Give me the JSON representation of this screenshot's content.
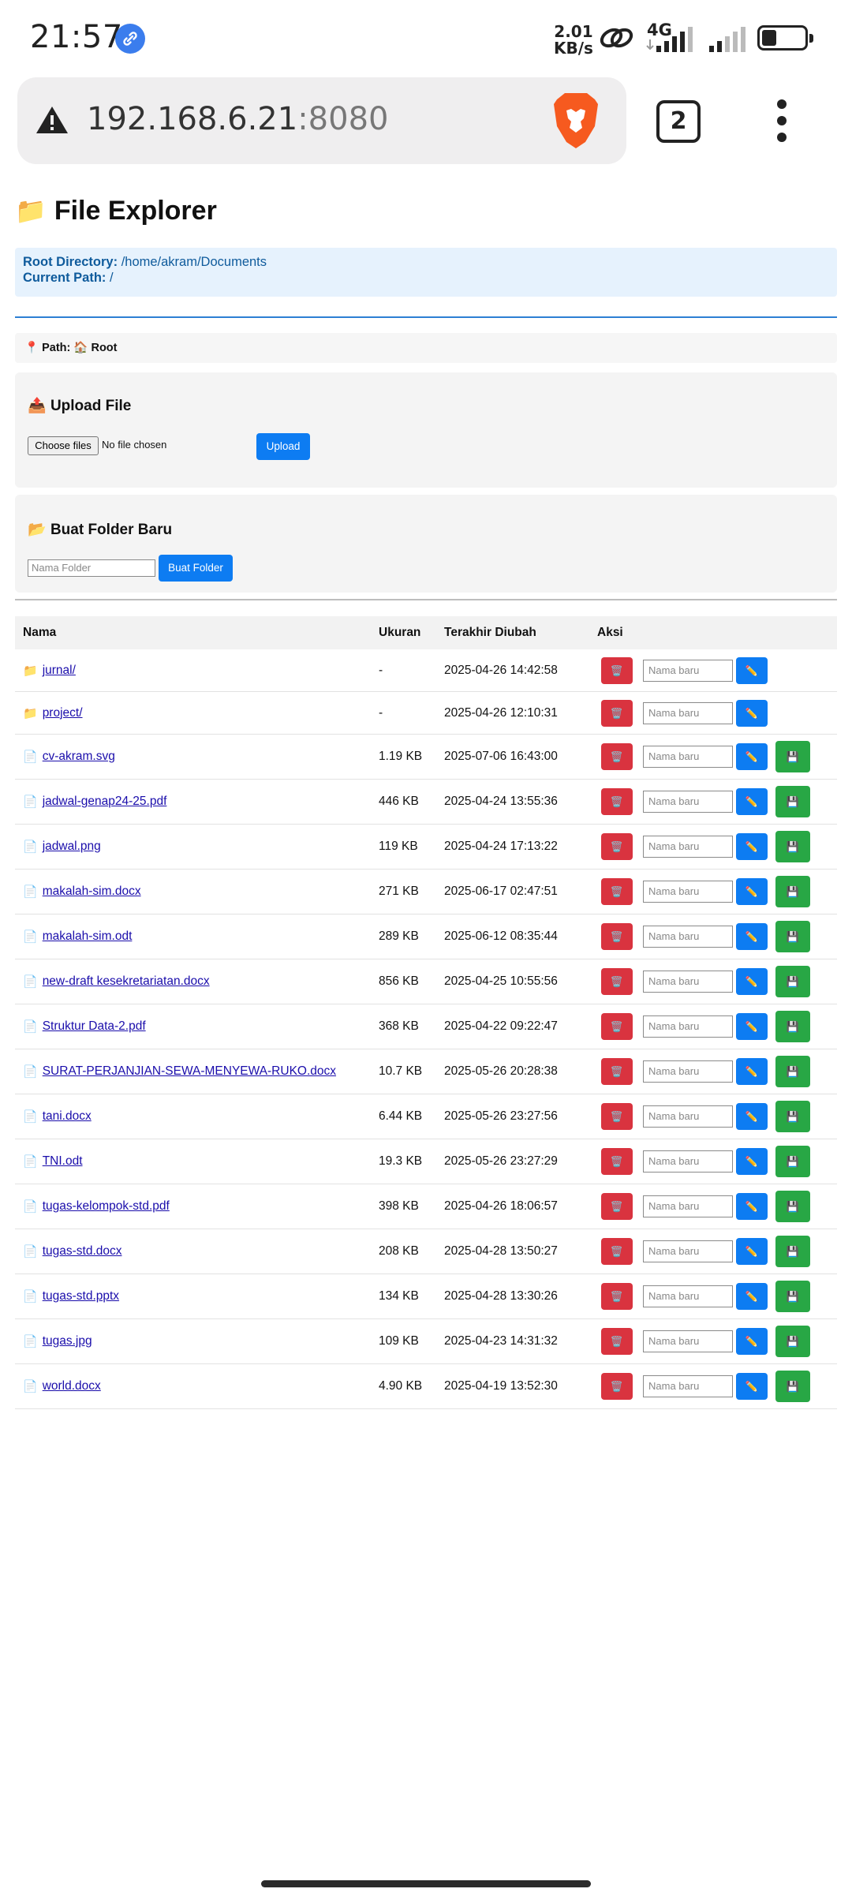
{
  "status_bar": {
    "time": "21:57",
    "net_speed_value": "2.01",
    "net_speed_unit": "KB/s",
    "network_type": "4G",
    "icons": [
      "link-icon",
      "hotspot-icon",
      "signal-icon",
      "battery-icon"
    ]
  },
  "browser": {
    "url_host": "192.168.6.21",
    "url_port": ":8080",
    "tab_count": "2",
    "icons": [
      "warning-icon",
      "brave-lion-icon",
      "more-vert-icon"
    ]
  },
  "page": {
    "title_icon": "📁",
    "title": "File Explorer",
    "root_label": "Root Directory:",
    "root_value": "/home/akram/Documents",
    "current_label": "Current Path:",
    "current_value": "/",
    "path_pin": "📍",
    "path_label": "Path:",
    "path_home_icon": "🏠",
    "path_value": "Root"
  },
  "upload": {
    "icon": "📤",
    "title": "Upload File",
    "choose_label": "Choose files",
    "no_file": "No file chosen",
    "button": "Upload"
  },
  "new_folder": {
    "icon": "📂",
    "title": "Buat Folder Baru",
    "placeholder": "Nama Folder",
    "button": "Buat Folder"
  },
  "table": {
    "headers": {
      "name": "Nama",
      "size": "Ukuran",
      "modified": "Terakhir Diubah",
      "actions": "Aksi"
    },
    "rename_placeholder": "Nama baru",
    "delete_icon": "🗑️",
    "rename_icon": "✏️",
    "save_icon": "💾",
    "folder_icon": "📁",
    "file_icon": "📄",
    "rows": [
      {
        "name": "jurnal/",
        "size": "-",
        "modified": "2025-04-26 14:42:58",
        "is_dir": true
      },
      {
        "name": "project/",
        "size": "-",
        "modified": "2025-04-26 12:10:31",
        "is_dir": true
      },
      {
        "name": "cv-akram.svg",
        "size": "1.19 KB",
        "modified": "2025-07-06 16:43:00",
        "is_dir": false
      },
      {
        "name": "jadwal-genap24-25.pdf",
        "size": "446 KB",
        "modified": "2025-04-24 13:55:36",
        "is_dir": false
      },
      {
        "name": "jadwal.png",
        "size": "119 KB",
        "modified": "2025-04-24 17:13:22",
        "is_dir": false
      },
      {
        "name": "makalah-sim.docx",
        "size": "271 KB",
        "modified": "2025-06-17 02:47:51",
        "is_dir": false
      },
      {
        "name": "makalah-sim.odt",
        "size": "289 KB",
        "modified": "2025-06-12 08:35:44",
        "is_dir": false
      },
      {
        "name": "new-draft kesekretariatan.docx",
        "size": "856 KB",
        "modified": "2025-04-25 10:55:56",
        "is_dir": false
      },
      {
        "name": "Struktur Data-2.pdf",
        "size": "368 KB",
        "modified": "2025-04-22 09:22:47",
        "is_dir": false
      },
      {
        "name": "SURAT-PERJANJIAN-SEWA-MENYEWA-RUKO.docx",
        "size": "10.7 KB",
        "modified": "2025-05-26 20:28:38",
        "is_dir": false
      },
      {
        "name": "tani.docx",
        "size": "6.44 KB",
        "modified": "2025-05-26 23:27:56",
        "is_dir": false
      },
      {
        "name": "TNI.odt",
        "size": "19.3 KB",
        "modified": "2025-05-26 23:27:29",
        "is_dir": false
      },
      {
        "name": "tugas-kelompok-std.pdf",
        "size": "398 KB",
        "modified": "2025-04-26 18:06:57",
        "is_dir": false
      },
      {
        "name": "tugas-std.docx",
        "size": "208 KB",
        "modified": "2025-04-28 13:50:27",
        "is_dir": false
      },
      {
        "name": "tugas-std.pptx",
        "size": "134 KB",
        "modified": "2025-04-28 13:30:26",
        "is_dir": false
      },
      {
        "name": "tugas.jpg",
        "size": "109 KB",
        "modified": "2025-04-23 14:31:32",
        "is_dir": false
      },
      {
        "name": "world.docx",
        "size": "4.90 KB",
        "modified": "2025-04-19 13:52:30",
        "is_dir": false
      }
    ]
  },
  "colors": {
    "primary_button": "#0d7cf2",
    "danger_button": "#d9333f",
    "success_button": "#28a745",
    "info_bg": "#e6f2fd",
    "link": "#1a0dab"
  }
}
